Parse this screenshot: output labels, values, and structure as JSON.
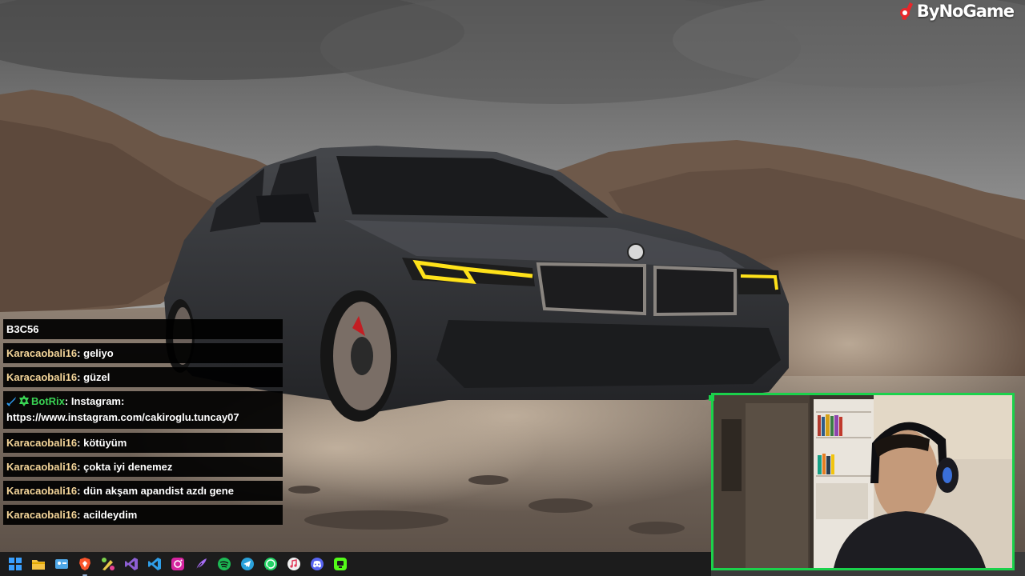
{
  "brand": {
    "name": "ByNoGame"
  },
  "chat": {
    "messages": [
      {
        "user": "",
        "text": "B3C56"
      },
      {
        "user": "Karacaobali16",
        "sep": ":",
        "text": " geliyo"
      },
      {
        "user": "Karacaobali16",
        "sep": ":",
        "text": " güzel"
      },
      {
        "user": "BotRix",
        "sep": ":",
        "text": " Instagram: https://www.instagram.com/cakiroglu.tuncay07",
        "bot": true
      },
      {
        "user": "Karacaobali16",
        "sep": ":",
        "text": " kötüyüm"
      },
      {
        "user": "Karacaobali16",
        "sep": ":",
        "text": " çokta iyi denemez"
      },
      {
        "user": "Karacaobali16",
        "sep": ":",
        "text": " dün akşam apandist azdı gene"
      },
      {
        "user": "Karacaobali16",
        "sep": ":",
        "text": " acildeydim"
      }
    ]
  },
  "colors": {
    "username": "#f5d69a",
    "bot_username": "#39d353",
    "webcam_border": "#1bd14b",
    "taskbar": "#1c1c1c"
  },
  "taskbar": {
    "icons": [
      "windows-start-icon",
      "file-explorer-icon",
      "widgets-icon",
      "brave-browser-icon",
      "paint-icon",
      "visual-studio-icon",
      "vscode-icon",
      "instagram-icon",
      "feather-app-icon",
      "spotify-icon",
      "telegram-icon",
      "whatsapp-icon",
      "itunes-icon",
      "discord-icon",
      "stream-app-icon"
    ]
  }
}
